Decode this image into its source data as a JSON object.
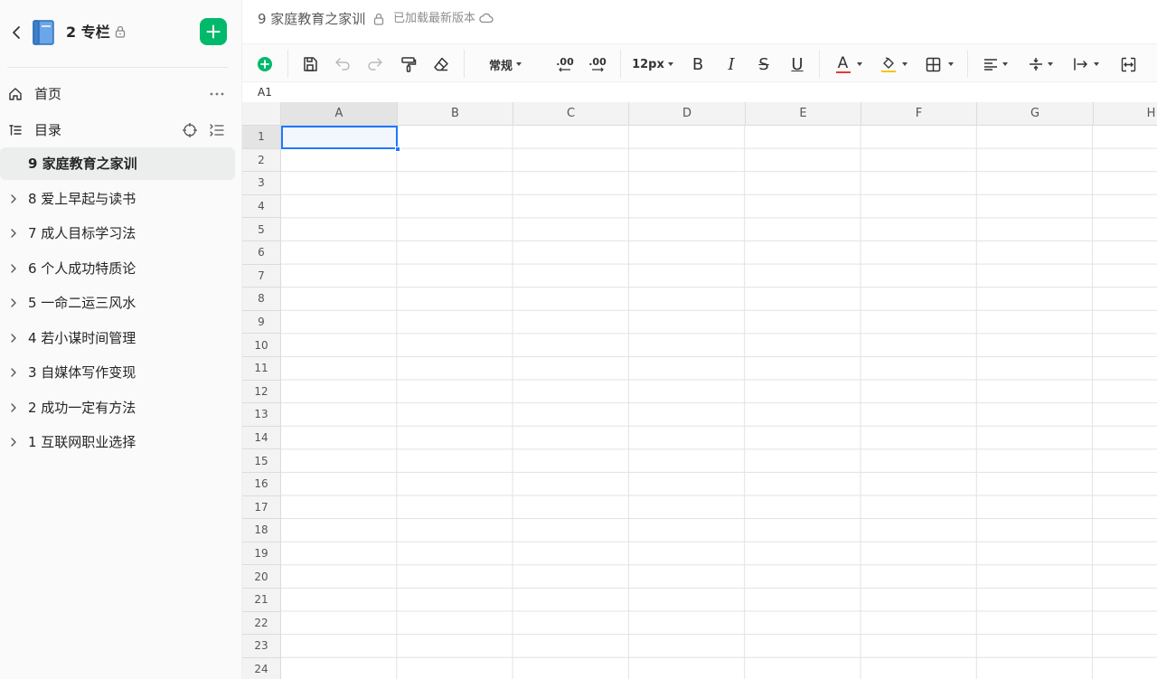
{
  "sidebar": {
    "title": "2 专栏",
    "home_label": "首页",
    "toc_label": "目录",
    "toc_items": [
      {
        "label": "9 家庭教育之家训"
      },
      {
        "label": "8 爱上早起与读书"
      },
      {
        "label": "7 成人目标学习法"
      },
      {
        "label": "6 个人成功特质论"
      },
      {
        "label": "5 一命二运三风水"
      },
      {
        "label": "4 若小谋时间管理"
      },
      {
        "label": "3 自媒体写作变现"
      },
      {
        "label": "2 成功一定有方法"
      },
      {
        "label": "1 互联网职业选择"
      }
    ]
  },
  "header": {
    "doc_title": "9 家庭教育之家训",
    "status": "已加载最新版本"
  },
  "toolbar": {
    "number_format": "常规",
    "decimal_decrease": ".00",
    "decimal_increase": ".00",
    "font_size": "12px",
    "bold": "B",
    "italic": "I",
    "strike": "S",
    "underline": "U",
    "font_color_letter": "A",
    "accent_color": "#00b96b",
    "text_color_bar": "#e53935",
    "fill_color_bar": "#f5c518"
  },
  "formula_bar": {
    "cell_ref": "A1"
  },
  "sheet": {
    "columns": [
      "A",
      "B",
      "C",
      "D",
      "E",
      "F",
      "G",
      "H"
    ],
    "rows": [
      "1",
      "2",
      "3",
      "4",
      "5",
      "6",
      "7",
      "8",
      "9",
      "10",
      "11",
      "12",
      "13",
      "14",
      "15",
      "16",
      "17",
      "18",
      "19",
      "20",
      "21",
      "22",
      "23",
      "24"
    ],
    "selected_cell": "A1"
  }
}
